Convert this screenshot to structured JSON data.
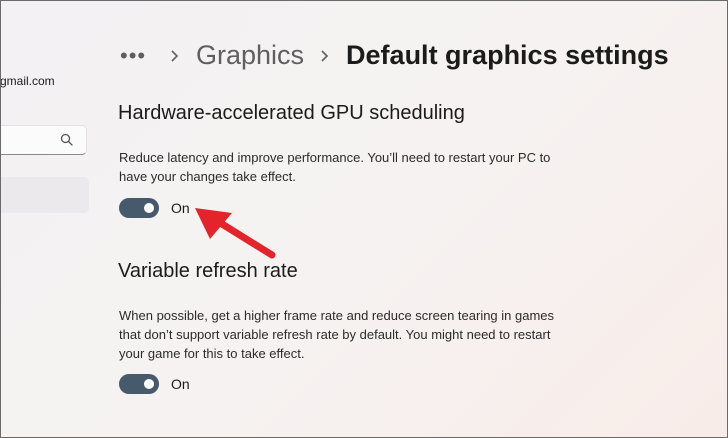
{
  "sidebar": {
    "account_email": "gmail.com",
    "search_icon": "search-icon"
  },
  "breadcrumb": {
    "more": "•••",
    "parent": "Graphics",
    "current": "Default graphics settings"
  },
  "gpu_scheduling": {
    "title": "Hardware-accelerated GPU scheduling",
    "description": "Reduce latency and improve performance. You’ll need to restart your PC to have your changes take effect.",
    "state_label": "On"
  },
  "variable_refresh": {
    "title": "Variable refresh rate",
    "description": "When possible, get a higher frame rate and reduce screen tearing in games that don’t support variable refresh rate by default. You might need to restart your game for this to take effect.",
    "state_label": "On"
  },
  "colors": {
    "toggle_on": "#475a6b",
    "annotation_arrow": "#e3242b"
  }
}
